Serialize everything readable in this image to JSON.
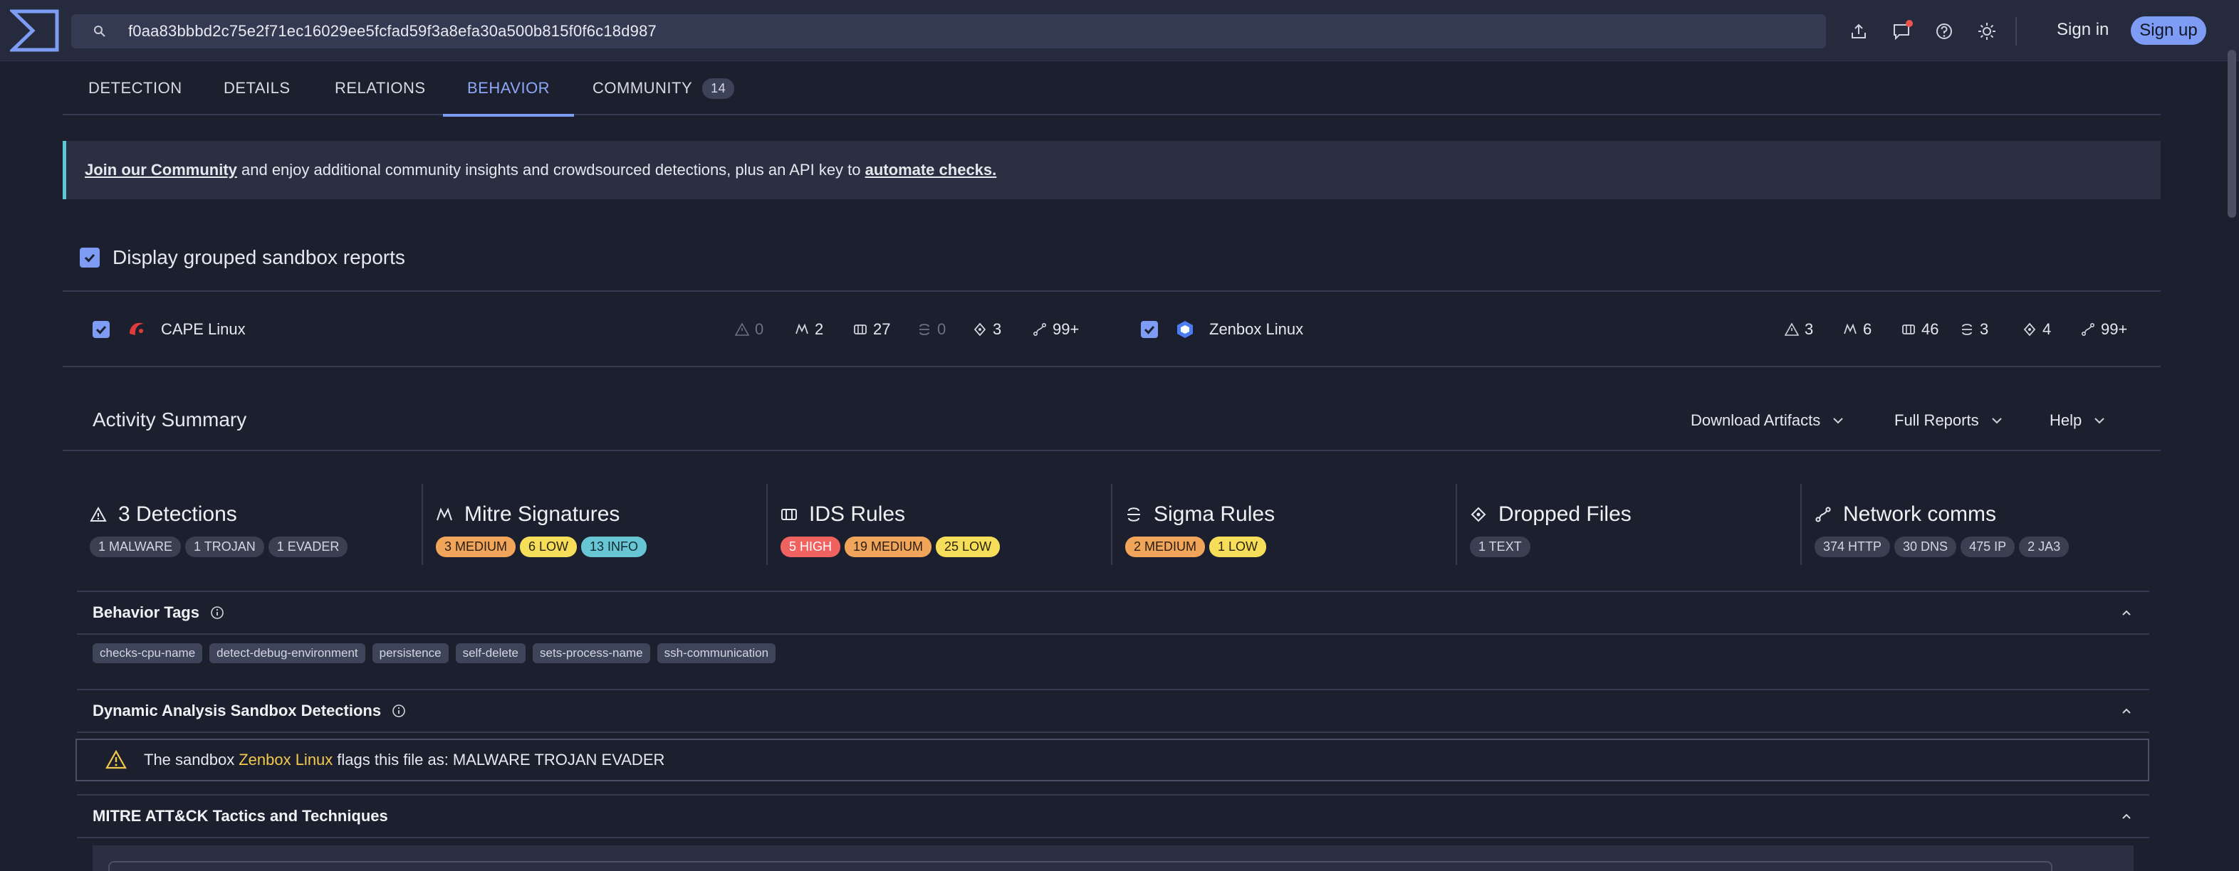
{
  "search": {
    "value": "f0aa83bbbd2c75e2f71ec16029ee5fcfad59f3a8efa30a500b815f0f6c18d987"
  },
  "header": {
    "sign_in": "Sign in",
    "sign_up": "Sign up"
  },
  "tabs": [
    {
      "label": "DETECTION"
    },
    {
      "label": "DETAILS"
    },
    {
      "label": "RELATIONS"
    },
    {
      "label": "BEHAVIOR",
      "active": true
    },
    {
      "label": "COMMUNITY",
      "badge": "14"
    }
  ],
  "banner": {
    "link1": "Join our Community",
    "middle": " and enjoy additional community insights and crowdsourced detections, plus an API key to ",
    "link2": "automate checks."
  },
  "group_toggle": {
    "label": "Display grouped sandbox reports"
  },
  "sandboxes": [
    {
      "name": "CAPE Linux",
      "stats": [
        "0",
        "2",
        "27",
        "0",
        "3",
        "99+"
      ]
    },
    {
      "name": "Zenbox Linux",
      "stats": [
        "3",
        "6",
        "46",
        "3",
        "4",
        "99+"
      ]
    }
  ],
  "activity": {
    "title": "Activity Summary",
    "download": "Download Artifacts",
    "reports": "Full Reports",
    "help": "Help"
  },
  "cards": [
    {
      "title": "3 Detections",
      "pills": [
        "1 MALWARE",
        "1 TROJAN",
        "1 EVADER"
      ]
    },
    {
      "title": "Mitre Signatures",
      "pills": [
        "3 MEDIUM",
        "6 LOW",
        "13 INFO"
      ]
    },
    {
      "title": "IDS Rules",
      "pills": [
        "5 HIGH",
        "19 MEDIUM",
        "25 LOW"
      ]
    },
    {
      "title": "Sigma Rules",
      "pills": [
        "2 MEDIUM",
        "1 LOW"
      ]
    },
    {
      "title": "Dropped Files",
      "pills": [
        "1 TEXT"
      ]
    },
    {
      "title": "Network comms",
      "pills": [
        "374 HTTP",
        "30 DNS",
        "475 IP",
        "2 JA3"
      ]
    }
  ],
  "behavior_tags": {
    "title": "Behavior Tags",
    "tags": [
      "checks-cpu-name",
      "detect-debug-environment",
      "persistence",
      "self-delete",
      "sets-process-name",
      "ssh-communication"
    ]
  },
  "dynamic": {
    "title": "Dynamic Analysis Sandbox Detections",
    "prefix": "The sandbox",
    "sandbox": "Zenbox Linux",
    "suffix": "flags this file as: MALWARE TROJAN EVADER"
  },
  "mitre": {
    "title": "MITRE ATT&CK Tactics and Techniques"
  },
  "colors": {
    "accent": "#7f9cf5",
    "background": "#1c1f2e",
    "topbar": "#252a3c",
    "warning": "#f2c94c"
  }
}
